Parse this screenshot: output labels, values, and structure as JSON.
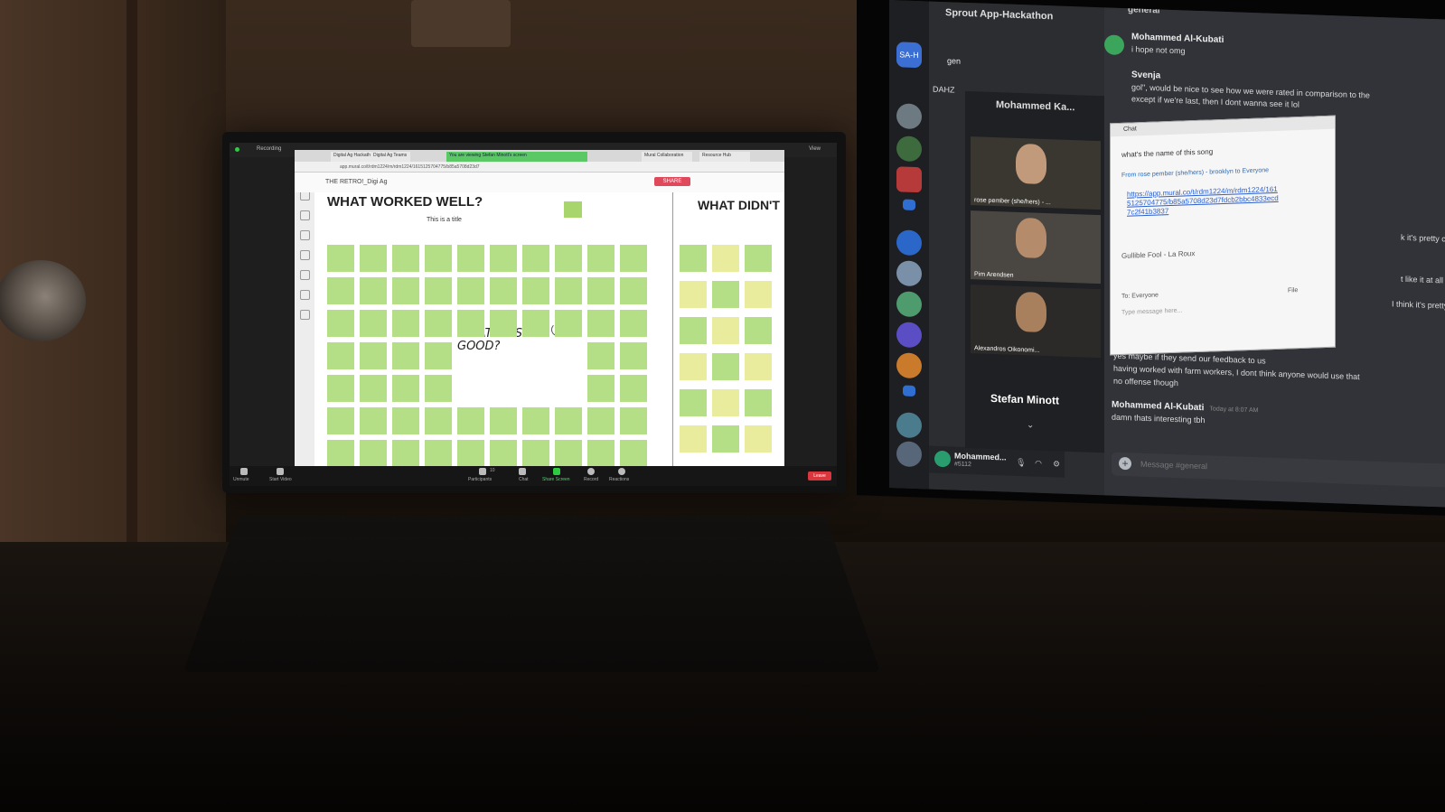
{
  "laptop": {
    "zoom_top": {
      "recording_label": "Recording",
      "view_label": "View"
    },
    "browser": {
      "tabs": [
        "Digital Ag Hackath...",
        "Digital Ag Teams",
        "You are viewing Stefan Minott's screen",
        "Mural Collaboration",
        "Resource Hub"
      ],
      "active_tab": "You are viewing Stefan Minott's screen",
      "url": "app.mural.co/t/rdm1224/m/rdm1224/1615125704775/b85a5708d23d7"
    },
    "mural": {
      "board_name": "THE RETRO!_Digi Ag",
      "share_label": "SHARE",
      "what_worked_well": "WHAT WORKED WELL?",
      "what_didnt": "WHAT DIDN'T",
      "small_title": "This is a title",
      "what_was_good": "WHAT WAS GOOD?"
    },
    "zoom_bar": {
      "unmute": "Unmute",
      "start_video": "Start Video",
      "participants": "Participants",
      "participants_count": "10",
      "chat": "Chat",
      "share_screen": "Share Screen",
      "record": "Record",
      "reactions": "Reactions",
      "leave": "Leave"
    }
  },
  "discord": {
    "server_name": "Sprout App-Hackathon",
    "server_badge": "SA-H",
    "server_dahz": "DAHZ",
    "channel_general": "gen",
    "voice_panel_title": "Mohammed  Ka...",
    "video_tiles": [
      {
        "name": "rose pember (she/hers) - ..."
      },
      {
        "name": "Pim Arendsen"
      },
      {
        "name": "Alexandros Oikonomi..."
      }
    ],
    "speaking": "Stefan Minott",
    "chat_header": "general",
    "messages": [
      {
        "author": "Mohammed Al-Kubati",
        "text": "i hope not omg"
      },
      {
        "author": "Svenja",
        "text": "gol\", would be nice to see how we were rated in comparison to the",
        "text2": "except if we're last, then I dont wanna see it lol"
      },
      {
        "text": "k it's pretty cruc"
      },
      {
        "text": "t like it at all"
      },
      {
        "text": "I think it's pretty cr"
      },
      {
        "text": "yes maybe if they send our feedback to us"
      },
      {
        "text": "having worked with farm workers, I dont think anyone would use that"
      },
      {
        "text": "no offense though"
      },
      {
        "author": "Mohammed Al-Kubati",
        "time": "Today at 8:07 AM",
        "text": "damn thats interesting tbh"
      }
    ],
    "input_placeholder": "Message #general",
    "user": {
      "name": "Mohammed...",
      "tag": "#5112"
    }
  },
  "zoom_chat": {
    "title": "Chat",
    "line1": "what's the name of this song",
    "from": "From rose pember (she/hers) - brooklyn to Everyone",
    "link": "https://app.mural.co/t/rdm1224/m/rdm1224/1615125704775/b85a5708d23d7fdcb2bbc4833ecd7c2f41b3837",
    "line2": "Gullible Fool - La Roux",
    "to_label": "To:",
    "to_value": "Everyone",
    "file_label": "File",
    "input_placeholder": "Type message here..."
  }
}
